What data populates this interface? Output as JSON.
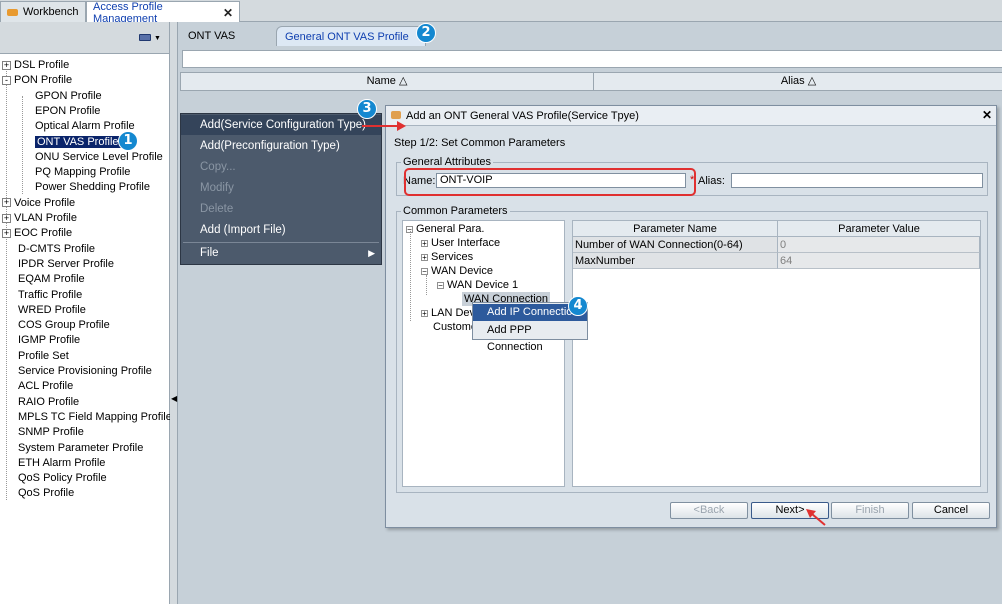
{
  "top_tabs": {
    "workbench": "Workbench",
    "apm": "Access Profile Management"
  },
  "left_tree": [
    {
      "label": "DSL Profile",
      "expander": "+"
    },
    {
      "label": "PON Profile",
      "expander": "-"
    },
    {
      "label": "GPON Profile"
    },
    {
      "label": "EPON Profile"
    },
    {
      "label": "Optical Alarm Profile"
    },
    {
      "label": "ONT VAS Profile"
    },
    {
      "label": "ONU Service Level Profile"
    },
    {
      "label": "PQ Mapping Profile"
    },
    {
      "label": "Power Shedding Profile"
    },
    {
      "label": "Voice Profile",
      "expander": "+"
    },
    {
      "label": "VLAN Profile",
      "expander": "+"
    },
    {
      "label": "EOC Profile",
      "expander": "+"
    },
    {
      "label": "D-CMTS Profile"
    },
    {
      "label": "IPDR Server Profile"
    },
    {
      "label": "EQAM Profile"
    },
    {
      "label": "Traffic Profile"
    },
    {
      "label": "WRED Profile"
    },
    {
      "label": "COS Group Profile"
    },
    {
      "label": "IGMP Profile"
    },
    {
      "label": "Profile Set"
    },
    {
      "label": "Service Provisioning Profile"
    },
    {
      "label": "ACL Profile"
    },
    {
      "label": "RAIO Profile"
    },
    {
      "label": "MPLS TC Field Mapping Profile"
    },
    {
      "label": "SNMP Profile"
    },
    {
      "label": "System Parameter Profile"
    },
    {
      "label": "ETH Alarm Profile"
    },
    {
      "label": "QoS Policy Profile"
    },
    {
      "label": "QoS Profile"
    }
  ],
  "sub_tabs": {
    "ont": "ONT VAS Profile",
    "general": "General ONT VAS Profile"
  },
  "columns": {
    "name": "Name △",
    "alias": "Alias △"
  },
  "context_menu": {
    "add_service": "Add(Service Configuration Type)",
    "add_preconfig": "Add(Preconfiguration Type)",
    "copy": "Copy...",
    "modify": "Modify",
    "delete": "Delete",
    "add_import": "Add (Import File)",
    "file": "File"
  },
  "dialog": {
    "title": "Add an ONT General VAS Profile(Service Tpye)",
    "step": "Step 1/2: Set Common Parameters",
    "general_attributes": "General Attributes",
    "name_label": "Name:",
    "name_value": "ONT-VOIP",
    "required_star": "*",
    "alias_label": "Alias:",
    "alias_value": "",
    "common_parameters": "Common Parameters",
    "param_tree": {
      "general_para": "General Para.",
      "user_interface": "User Interface",
      "services": "Services",
      "wan_device": "WAN Device",
      "wan_device_1": "WAN Device 1",
      "wan_connection": "WAN Connection",
      "lan_device": "LAN Devi",
      "custom": "Custome"
    },
    "table": {
      "headers": [
        "Parameter Name",
        "Parameter Value"
      ],
      "rows": [
        [
          "Number of WAN Connection(0-64)",
          "0"
        ],
        [
          "MaxNumber",
          "64"
        ]
      ]
    },
    "popup": {
      "add_ip": "Add IP Connection",
      "add_ppp": "Add PPP Connection"
    },
    "buttons": {
      "back": "<Back",
      "next": "Next>",
      "finish": "Finish",
      "cancel": "Cancel"
    }
  },
  "badges": [
    "1",
    "2",
    "3",
    "4"
  ],
  "colors": {
    "badge": "#1488d0",
    "menu_bg": "#4c5a6c",
    "highlight_red": "#e03030",
    "selection": "#0a246a"
  }
}
